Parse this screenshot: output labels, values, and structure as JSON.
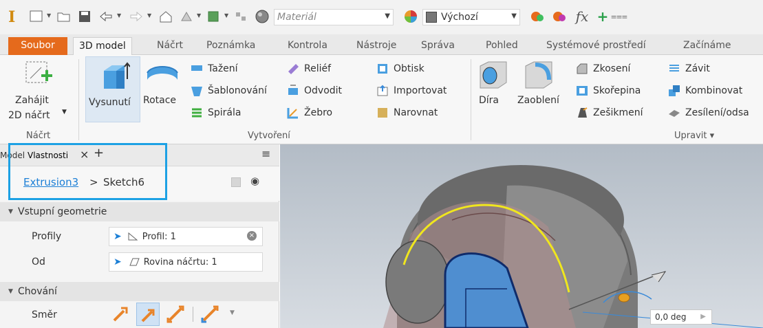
{
  "app": {
    "logo": "I"
  },
  "qat": {
    "material_placeholder": "Materiál",
    "appearance_value": "Výchozí",
    "fx": "fx"
  },
  "tabs": [
    "Soubor",
    "3D model",
    "Náčrt",
    "Poznámka",
    "Kontrola",
    "Nástroje",
    "Správa",
    "Pohled",
    "Systémové prostředí",
    "Začínáme"
  ],
  "ribbon": {
    "sketch": {
      "button": "Zahájit",
      "button2": "2D náčrt",
      "group": "Náčrt"
    },
    "create": {
      "extrude": "Vysunutí",
      "revolve": "Rotace",
      "col1": [
        "Tažení",
        "Šablonování",
        "Spirála"
      ],
      "col2": [
        "Reliéf",
        "Odvodit",
        "Žebro"
      ],
      "col3": [
        "Obtisk",
        "Importovat",
        "Narovnat"
      ],
      "group": "Vytvoření"
    },
    "modify": {
      "hole": "Díra",
      "fillet": "Zaoblení",
      "col1": [
        "Zkosení",
        "Skořepina",
        "Zešikmení"
      ],
      "col2": [
        "Závit",
        "Kombinovat",
        "Zesílení/odsa"
      ],
      "group": "Upravit ▾"
    }
  },
  "panel": {
    "tab_model": "Model",
    "tab_props": "Vlastnosti",
    "close": "×",
    "add": "+",
    "breadcrumb": [
      "Extrusion3",
      "Sketch6"
    ],
    "section_input": "Vstupní geometrie",
    "profiles_label": "Profily",
    "profiles_value": "Profil: 1",
    "from_label": "Od",
    "from_value": "Rovina náčrtu: 1",
    "section_behavior": "Chování",
    "direction_label": "Směr"
  },
  "viewport": {
    "angle": "0,0 deg"
  },
  "colors": {
    "file_tab": "#e56a1c",
    "accent": "#1c7fd6",
    "highlight": "#1da1e4",
    "profile_edge": "#f0e61e"
  }
}
